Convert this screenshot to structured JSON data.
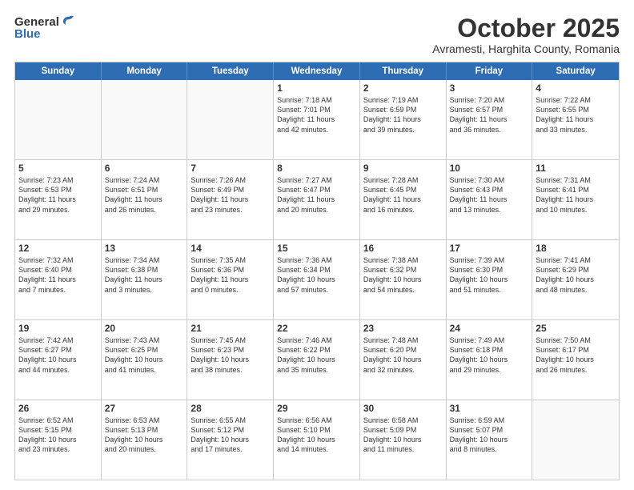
{
  "logo": {
    "general": "General",
    "blue": "Blue"
  },
  "header": {
    "month": "October 2025",
    "location": "Avramesti, Harghita County, Romania"
  },
  "weekdays": [
    "Sunday",
    "Monday",
    "Tuesday",
    "Wednesday",
    "Thursday",
    "Friday",
    "Saturday"
  ],
  "rows": [
    [
      {
        "day": "",
        "info": ""
      },
      {
        "day": "",
        "info": ""
      },
      {
        "day": "",
        "info": ""
      },
      {
        "day": "1",
        "info": "Sunrise: 7:18 AM\nSunset: 7:01 PM\nDaylight: 11 hours\nand 42 minutes."
      },
      {
        "day": "2",
        "info": "Sunrise: 7:19 AM\nSunset: 6:59 PM\nDaylight: 11 hours\nand 39 minutes."
      },
      {
        "day": "3",
        "info": "Sunrise: 7:20 AM\nSunset: 6:57 PM\nDaylight: 11 hours\nand 36 minutes."
      },
      {
        "day": "4",
        "info": "Sunrise: 7:22 AM\nSunset: 6:55 PM\nDaylight: 11 hours\nand 33 minutes."
      }
    ],
    [
      {
        "day": "5",
        "info": "Sunrise: 7:23 AM\nSunset: 6:53 PM\nDaylight: 11 hours\nand 29 minutes."
      },
      {
        "day": "6",
        "info": "Sunrise: 7:24 AM\nSunset: 6:51 PM\nDaylight: 11 hours\nand 26 minutes."
      },
      {
        "day": "7",
        "info": "Sunrise: 7:26 AM\nSunset: 6:49 PM\nDaylight: 11 hours\nand 23 minutes."
      },
      {
        "day": "8",
        "info": "Sunrise: 7:27 AM\nSunset: 6:47 PM\nDaylight: 11 hours\nand 20 minutes."
      },
      {
        "day": "9",
        "info": "Sunrise: 7:28 AM\nSunset: 6:45 PM\nDaylight: 11 hours\nand 16 minutes."
      },
      {
        "day": "10",
        "info": "Sunrise: 7:30 AM\nSunset: 6:43 PM\nDaylight: 11 hours\nand 13 minutes."
      },
      {
        "day": "11",
        "info": "Sunrise: 7:31 AM\nSunset: 6:41 PM\nDaylight: 11 hours\nand 10 minutes."
      }
    ],
    [
      {
        "day": "12",
        "info": "Sunrise: 7:32 AM\nSunset: 6:40 PM\nDaylight: 11 hours\nand 7 minutes."
      },
      {
        "day": "13",
        "info": "Sunrise: 7:34 AM\nSunset: 6:38 PM\nDaylight: 11 hours\nand 3 minutes."
      },
      {
        "day": "14",
        "info": "Sunrise: 7:35 AM\nSunset: 6:36 PM\nDaylight: 11 hours\nand 0 minutes."
      },
      {
        "day": "15",
        "info": "Sunrise: 7:36 AM\nSunset: 6:34 PM\nDaylight: 10 hours\nand 57 minutes."
      },
      {
        "day": "16",
        "info": "Sunrise: 7:38 AM\nSunset: 6:32 PM\nDaylight: 10 hours\nand 54 minutes."
      },
      {
        "day": "17",
        "info": "Sunrise: 7:39 AM\nSunset: 6:30 PM\nDaylight: 10 hours\nand 51 minutes."
      },
      {
        "day": "18",
        "info": "Sunrise: 7:41 AM\nSunset: 6:29 PM\nDaylight: 10 hours\nand 48 minutes."
      }
    ],
    [
      {
        "day": "19",
        "info": "Sunrise: 7:42 AM\nSunset: 6:27 PM\nDaylight: 10 hours\nand 44 minutes."
      },
      {
        "day": "20",
        "info": "Sunrise: 7:43 AM\nSunset: 6:25 PM\nDaylight: 10 hours\nand 41 minutes."
      },
      {
        "day": "21",
        "info": "Sunrise: 7:45 AM\nSunset: 6:23 PM\nDaylight: 10 hours\nand 38 minutes."
      },
      {
        "day": "22",
        "info": "Sunrise: 7:46 AM\nSunset: 6:22 PM\nDaylight: 10 hours\nand 35 minutes."
      },
      {
        "day": "23",
        "info": "Sunrise: 7:48 AM\nSunset: 6:20 PM\nDaylight: 10 hours\nand 32 minutes."
      },
      {
        "day": "24",
        "info": "Sunrise: 7:49 AM\nSunset: 6:18 PM\nDaylight: 10 hours\nand 29 minutes."
      },
      {
        "day": "25",
        "info": "Sunrise: 7:50 AM\nSunset: 6:17 PM\nDaylight: 10 hours\nand 26 minutes."
      }
    ],
    [
      {
        "day": "26",
        "info": "Sunrise: 6:52 AM\nSunset: 5:15 PM\nDaylight: 10 hours\nand 23 minutes."
      },
      {
        "day": "27",
        "info": "Sunrise: 6:53 AM\nSunset: 5:13 PM\nDaylight: 10 hours\nand 20 minutes."
      },
      {
        "day": "28",
        "info": "Sunrise: 6:55 AM\nSunset: 5:12 PM\nDaylight: 10 hours\nand 17 minutes."
      },
      {
        "day": "29",
        "info": "Sunrise: 6:56 AM\nSunset: 5:10 PM\nDaylight: 10 hours\nand 14 minutes."
      },
      {
        "day": "30",
        "info": "Sunrise: 6:58 AM\nSunset: 5:09 PM\nDaylight: 10 hours\nand 11 minutes."
      },
      {
        "day": "31",
        "info": "Sunrise: 6:59 AM\nSunset: 5:07 PM\nDaylight: 10 hours\nand 8 minutes."
      },
      {
        "day": "",
        "info": ""
      }
    ]
  ]
}
